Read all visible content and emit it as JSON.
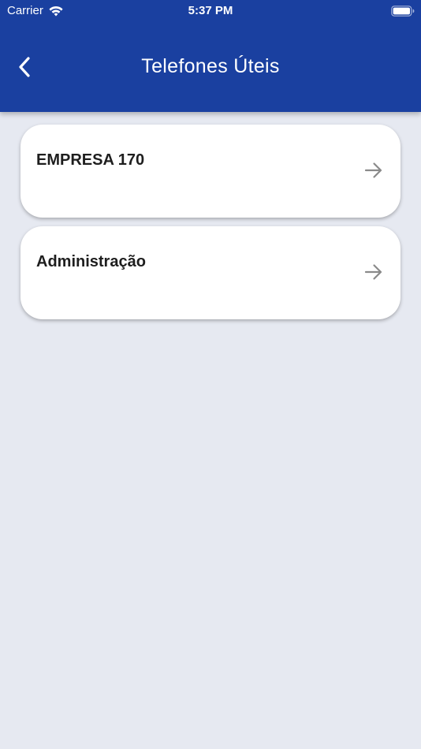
{
  "status_bar": {
    "carrier": "Carrier",
    "time": "5:37 PM",
    "wifi_icon": "wifi-icon",
    "battery_icon": "battery-icon"
  },
  "header": {
    "title": "Telefones Úteis",
    "back_icon": "chevron-left-icon",
    "background_color": "#1a40a0"
  },
  "list": {
    "items": [
      {
        "label": "EMPRESA 170",
        "icon": "arrow-right-icon"
      },
      {
        "label": "Administração",
        "icon": "arrow-right-icon"
      }
    ]
  },
  "colors": {
    "page_background": "#e6e9f1",
    "card_background": "#ffffff",
    "arrow": "#8a8a8a"
  }
}
